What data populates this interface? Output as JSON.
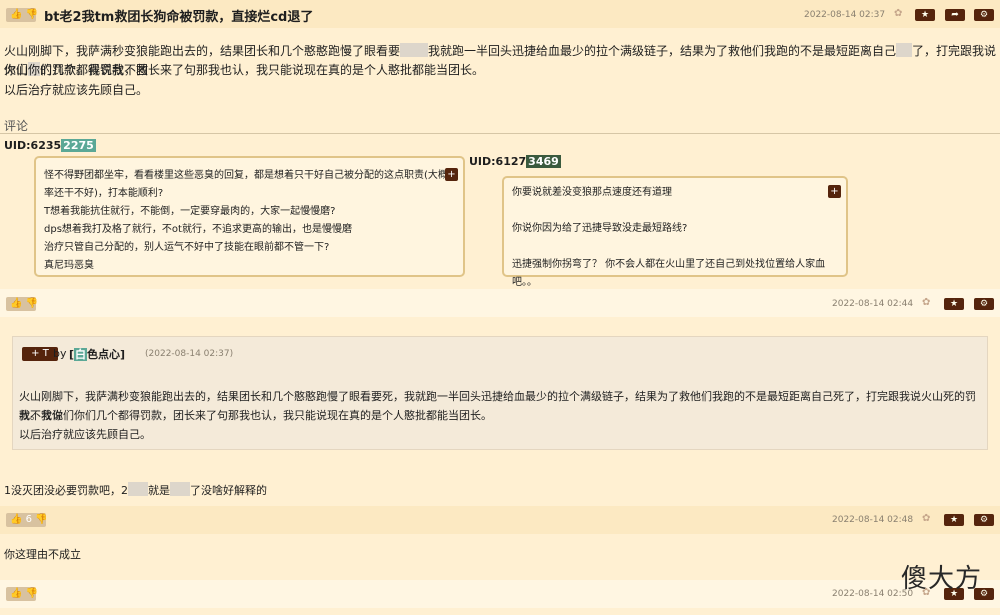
{
  "post": {
    "title": "bt老2我tm救团长狗命被罚款，直接烂cd退了",
    "timestamp": "2022-08-14 02:37",
    "body": [
      [
        "火山刚脚下，我萨满秒变狼能跑出去的，结果团长和几个憨憨跑慢了眼看要",
        "",
        "我就跑一半回头迅捷给血最少的拉个满级链子，结果为了救他们我跑的不是最短距离自己",
        "",
        "了，打完跟我说火山",
        "",
        "的罚款。我说我不救"
      ],
      [
        "你们你们几个都得罚款，团长来了句那我也认，我只能说现在真的是个人憨批都能当团长。"
      ],
      [
        "以后治疗就应该先顾自己。"
      ]
    ]
  },
  "comments_heading": "评论",
  "comment1": {
    "quote_left": {
      "uid_label": "UID:6235",
      "uid_badge": "2275",
      "badge_color": "#5ba896",
      "lines": [
        "怪不得野团都坐牢，看看楼里这些恶臭的回复，都是想着只干好自己被分配的这点职责(大概",
        "率还干不好)，打本能顺利?",
        "T想着我能抗住就行，不能倒，一定要穿最肉的，大家一起慢慢磨?",
        "dps想着我打及格了就行，不ot就行，不追求更高的输出，也是慢慢磨",
        "治疗只管自己分配的，别人运气不好中了技能在眼前都不管一下?",
        "真尼玛恶臭"
      ]
    },
    "quote_right": {
      "uid_label": "UID:6127",
      "uid_badge": "3469",
      "badge_color": "#3a5a3e",
      "lines": [
        "你要说就差没变狼那点速度还有道理",
        "",
        "你说你因为给了迅捷导致没走最短路线?",
        "",
        "迅捷强制你拐弯了？ 你不会人都在火山里了还自己到处找位置给人家血吧。。"
      ]
    },
    "timestamp": "2022-08-14 02:44"
  },
  "comment2": {
    "ref_by": "by",
    "ref_user_badge": "白",
    "ref_user_rest": "色点心",
    "ref_time": "(2022-08-14 02:37)",
    "ref_body": [
      "火山刚脚下，我萨满秒变狼能跑出去的，结果团长和几个憨憨跑慢了眼看要死，我就跑一半回头迅捷给血最少的拉个满级链子，结果为了救他们我跑的不是最短距离自己死了，打完跟我说火山死的罚款。我说",
      "我不救你们你们几个都得罚款，团长来了句那我也认，我只能说现在真的是个人憨批都能当团长。",
      "以后治疗就应该先顾自己。"
    ],
    "text_a": "1没灭团没必要罚款吧，2",
    "text_b": "就是",
    "text_c": "了没啥好解释的",
    "votes": "6",
    "timestamp": "2022-08-14 02:48"
  },
  "comment3": {
    "text": "你这理由不成立",
    "timestamp": "2022-08-14 02:50"
  },
  "watermark": "傻大方"
}
